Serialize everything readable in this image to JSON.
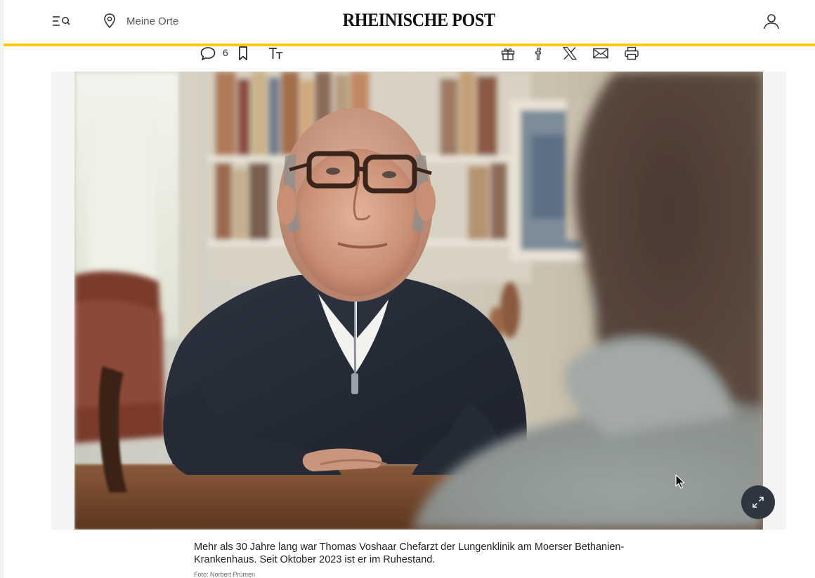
{
  "header": {
    "menu_icon": "menu-search-icon",
    "location_icon": "map-pin-icon",
    "location_label": "Meine Orte",
    "logo_text": "RHEINISCHE POST",
    "account_icon": "user-icon",
    "accent_color": "#ffcc00"
  },
  "toolbar": {
    "comment_icon": "comment-icon",
    "comment_count": "6",
    "bookmark_icon": "bookmark-icon",
    "textsize_icon": "text-size-icon",
    "share_icons": [
      "gift-icon",
      "facebook-icon",
      "x-icon",
      "mail-icon",
      "print-icon"
    ]
  },
  "media": {
    "image_alt": "Thomas Voshaar",
    "expand_icon": "expand-icon",
    "caption": "Mehr als 30 Jahre lang war Thomas Voshaar Chefarzt der Lungenklinik am Moerser Bethanien-Krankenhaus. Seit Oktober 2023 ist er im Ruhestand.",
    "credit": "Foto: Norbert Prümen"
  }
}
